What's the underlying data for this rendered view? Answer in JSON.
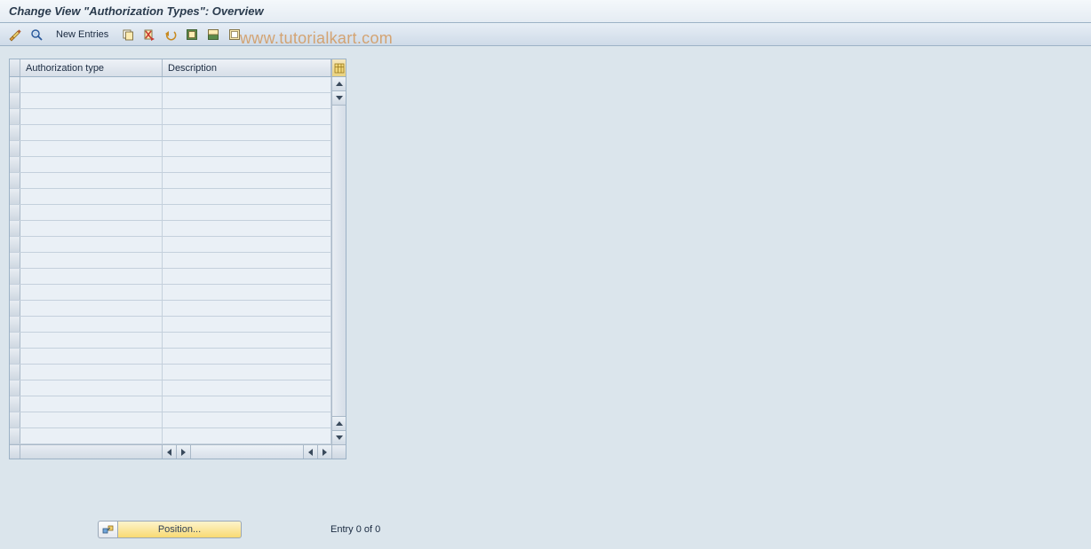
{
  "title": "Change View \"Authorization Types\": Overview",
  "toolbar": {
    "new_entries_label": "New Entries"
  },
  "watermark": "www.tutorialkart.com",
  "table": {
    "columns": {
      "c1": "Authorization type",
      "c2": "Description"
    },
    "row_count": 23
  },
  "footer": {
    "position_label": "Position...",
    "entry_text": "Entry 0 of 0"
  }
}
